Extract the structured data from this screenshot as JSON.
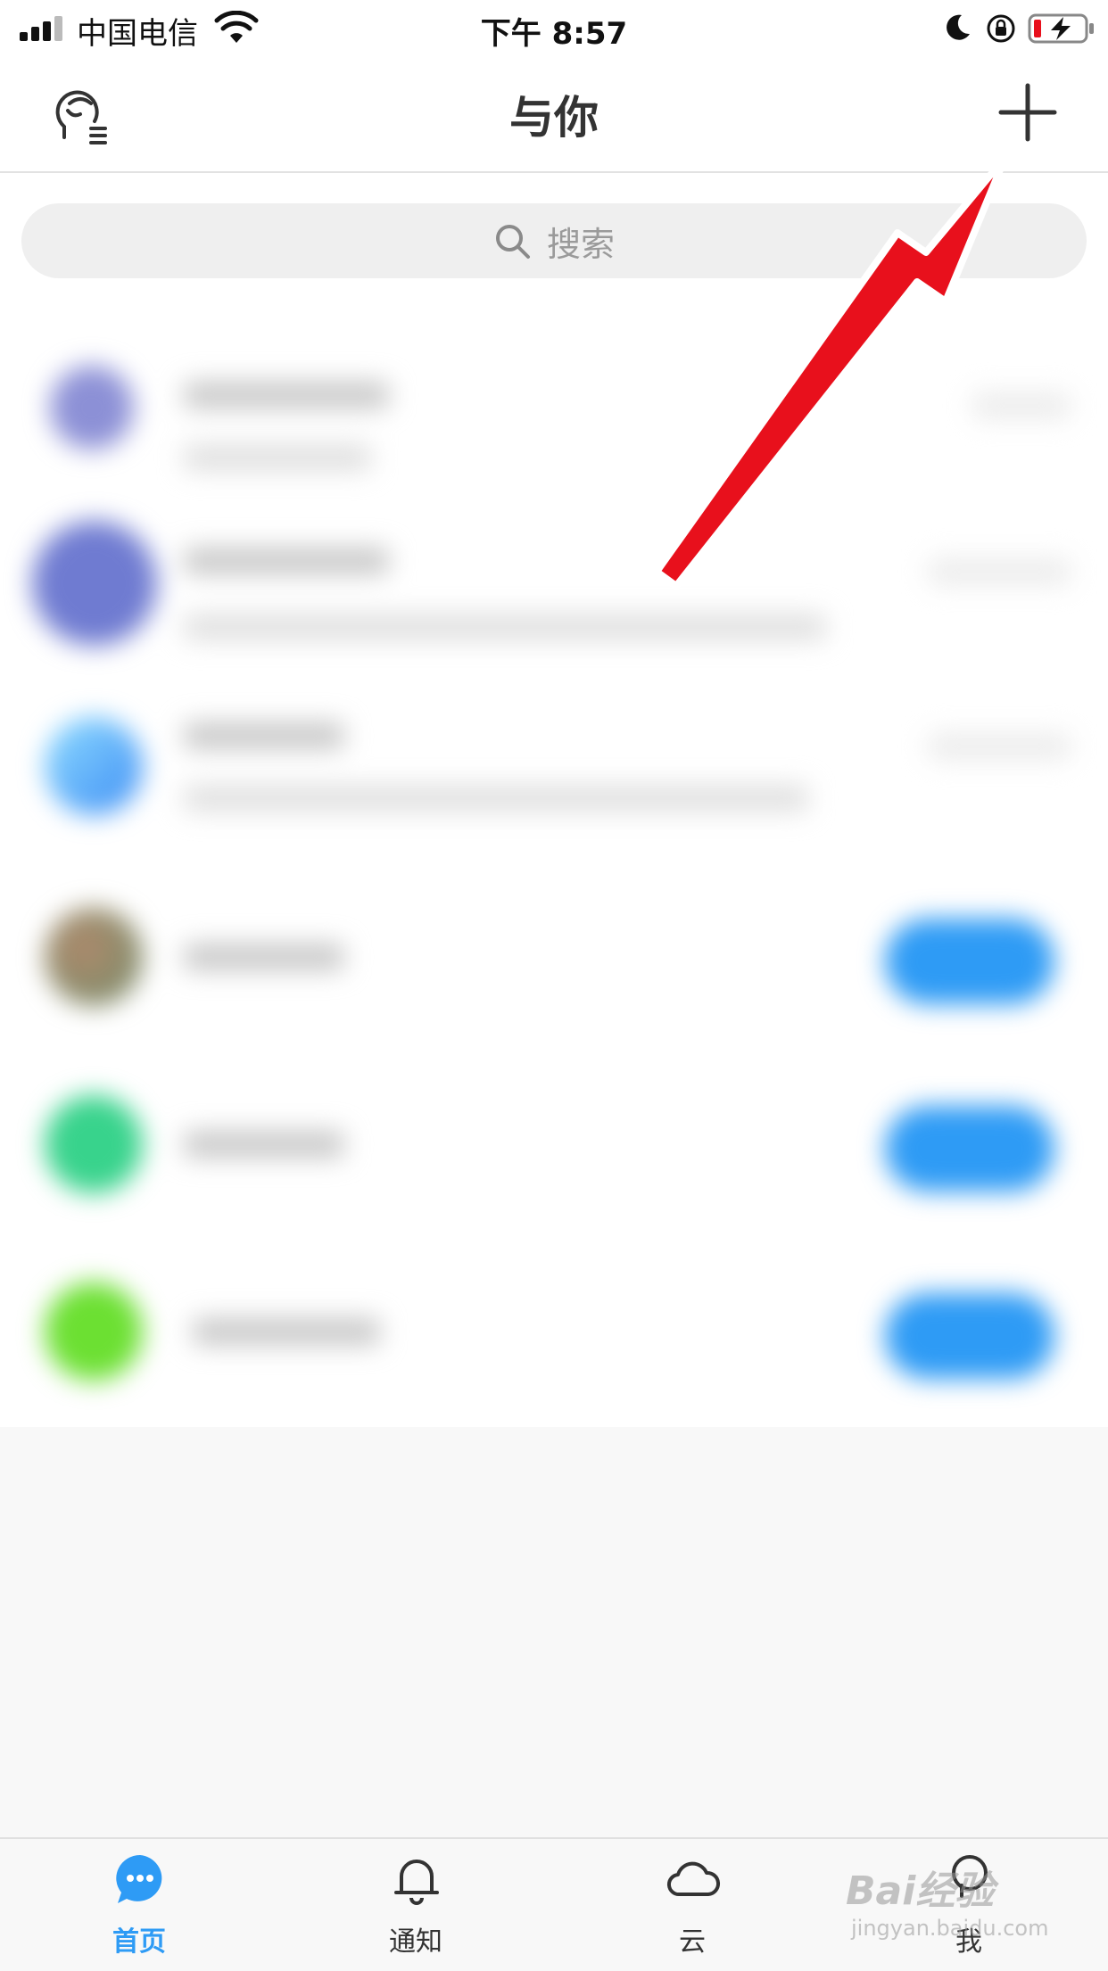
{
  "status_bar": {
    "carrier": "中国电信",
    "time": "下午 8:57",
    "icons": [
      "signal-icon",
      "wifi-icon",
      "moon-icon",
      "rotation-lock-icon",
      "battery-charging-icon"
    ]
  },
  "header": {
    "title": "与你",
    "left_icon": "avatar-menu-icon",
    "right_icon": "plus-icon"
  },
  "search": {
    "placeholder": "搜索",
    "icon": "search-icon"
  },
  "tabbar": {
    "tabs": [
      {
        "label": "首页",
        "icon": "chat-bubble-icon",
        "active": true
      },
      {
        "label": "通知",
        "icon": "bell-icon",
        "active": false
      },
      {
        "label": "云",
        "icon": "cloud-icon",
        "active": false
      },
      {
        "label": "我",
        "icon": "profile-icon",
        "active": false
      }
    ]
  },
  "watermark": {
    "brand": "Bai",
    "brand_suffix": "经验",
    "site": "jingyan.baidu.com"
  },
  "colors": {
    "accent": "#2e9bf5",
    "arrow": "#e8101c"
  }
}
